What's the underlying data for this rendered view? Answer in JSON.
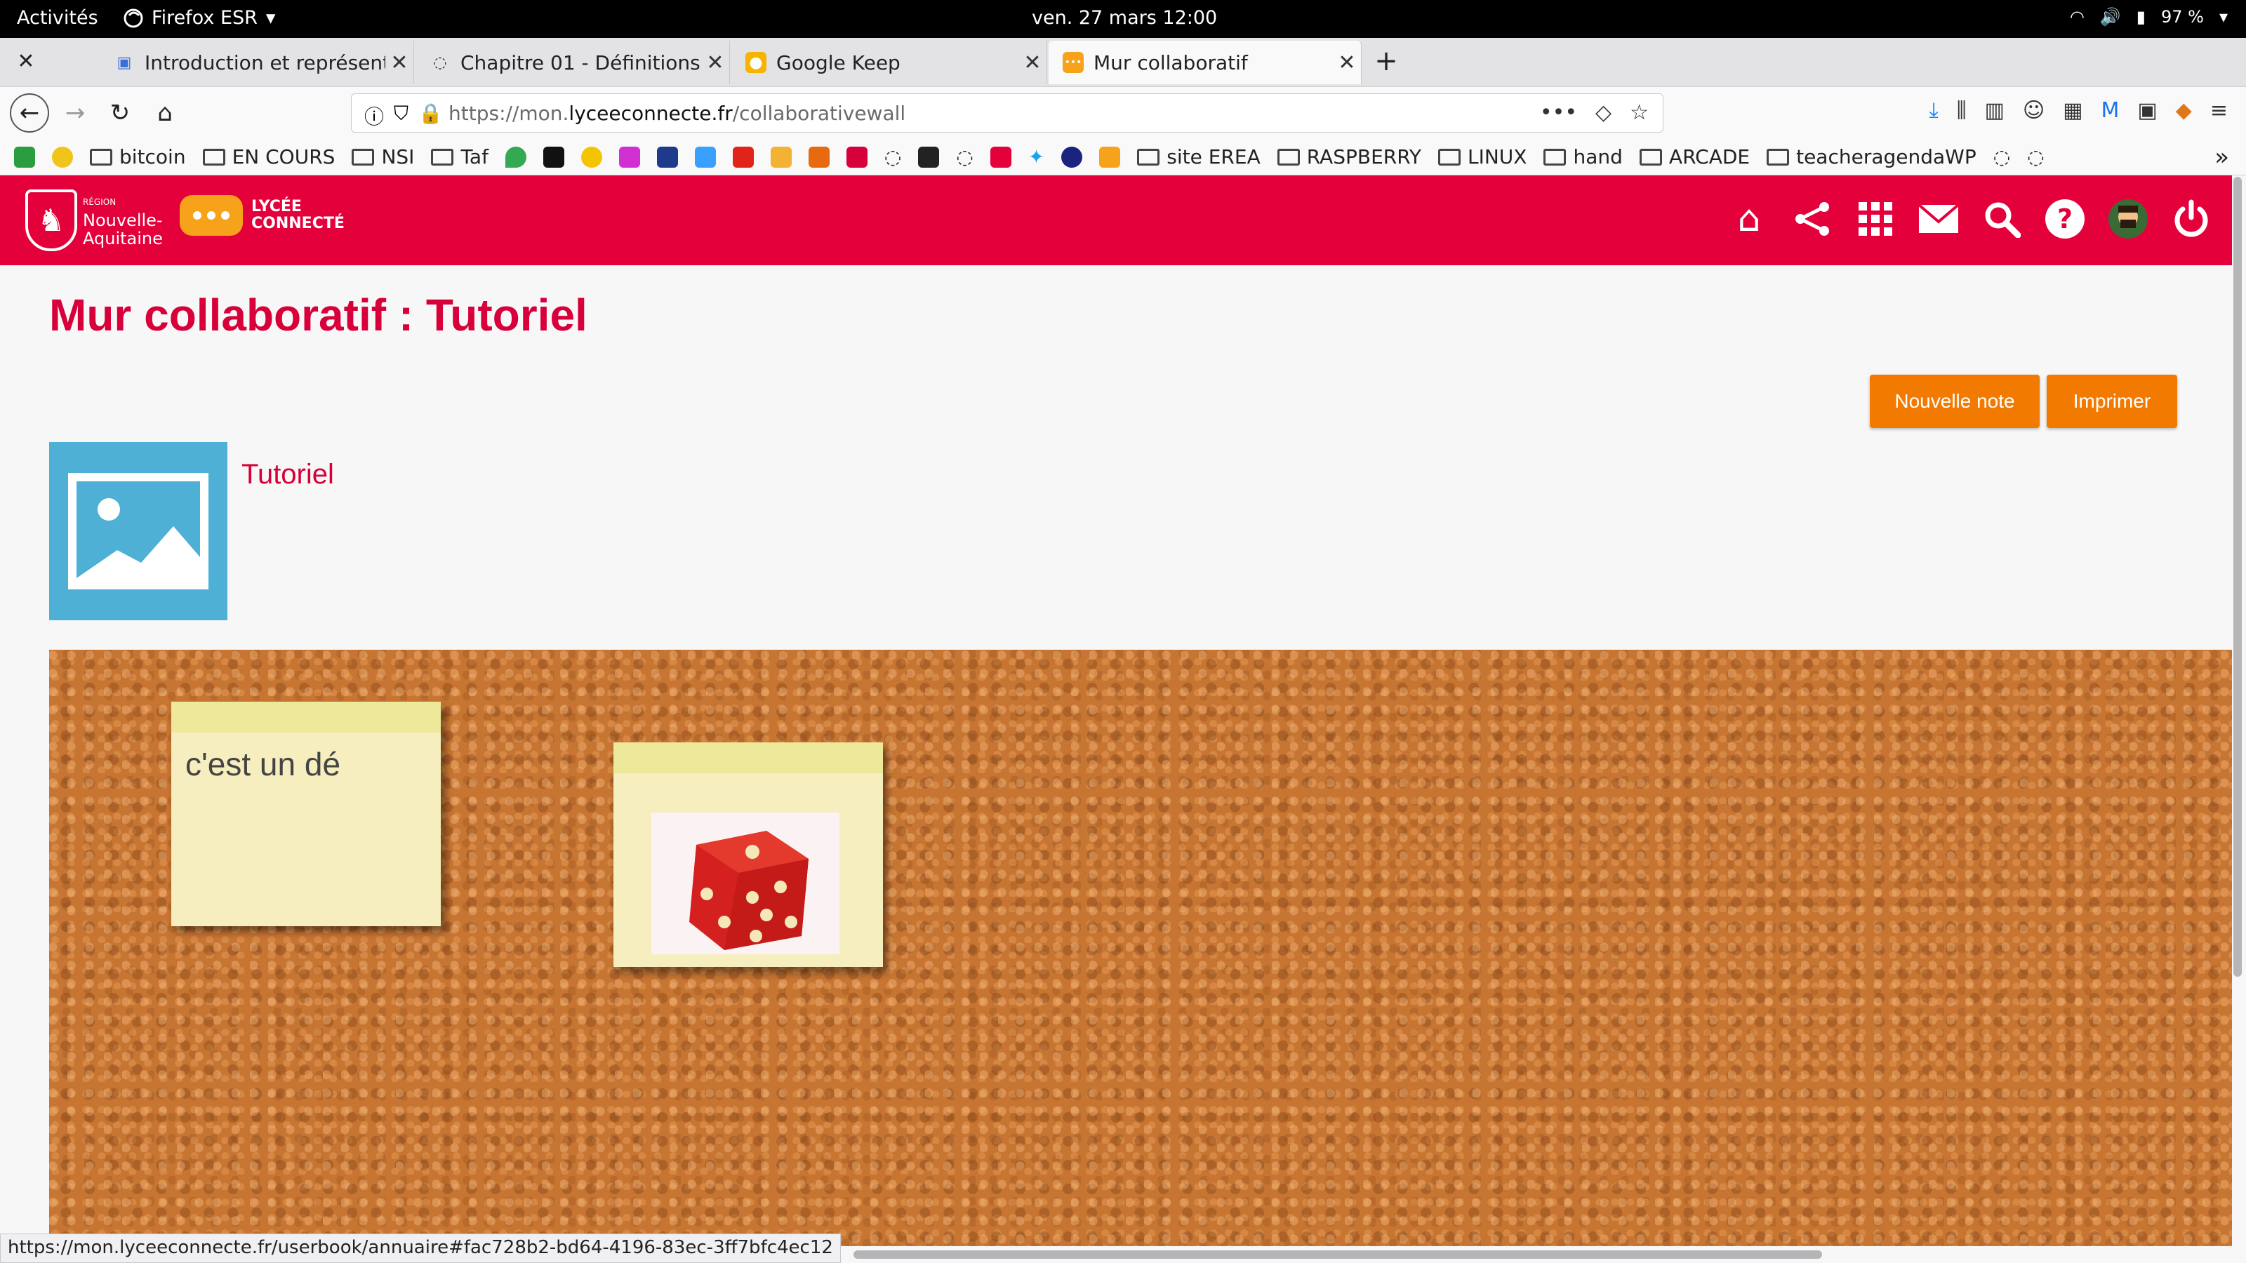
{
  "topbar": {
    "activities": "Activités",
    "app": "Firefox ESR",
    "datetime": "ven. 27 mars  12:00",
    "battery": "97 %"
  },
  "tabs": [
    {
      "title": "Introduction et représent",
      "icon": "doc-icon"
    },
    {
      "title": "Chapitre 01 - Définitions",
      "icon": "globe-icon"
    },
    {
      "title": "Google Keep",
      "icon": "keep-icon"
    },
    {
      "title": "Mur collaboratif",
      "icon": "lycee-icon"
    }
  ],
  "urlbar": {
    "prefix": "https://mon.",
    "domain": "lyceeconnecte.fr",
    "path": "/collaborativewall"
  },
  "bookmarks": [
    "bitcoin",
    "EN COURS",
    "NSI",
    "Taf",
    "site EREA",
    "RASPBERRY",
    "LINUX",
    "hand",
    "ARCADE",
    "teacheragendaWP"
  ],
  "header": {
    "region_small": "RÉGION",
    "region_line1": "Nouvelle-",
    "region_line2": "Aquitaine",
    "lycee_line1": "LYCÉE",
    "lycee_line2": "CONNECTÉ"
  },
  "page": {
    "title": "Mur collaboratif : Tutoriel",
    "new_note_label": "Nouvelle note",
    "print_label": "Imprimer",
    "wall_name": "Tutoriel"
  },
  "notes": [
    {
      "text": "c'est un dé"
    }
  ],
  "status_url": "https://mon.lyceeconnecte.fr/userbook/annuaire#fac728b2-bd64-4196-83ec-3ff7bfc4ec12",
  "colors": {
    "brand_red": "#e4003a",
    "title_red": "#d7003a",
    "button_orange": "#f37a00",
    "note_yellow": "#f6eebe",
    "cork": "#c77532"
  }
}
